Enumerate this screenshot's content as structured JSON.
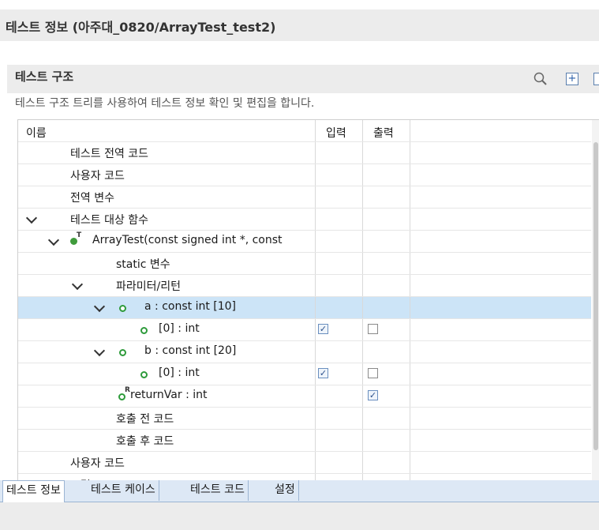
{
  "window": {
    "title": "테스트 정보 (아주대_0820/ArrayTest_test2)"
  },
  "section": {
    "title": "테스트 구조",
    "description": "테스트 구조 트리를 사용하여 테스트 정보 확인 및 편집을 합니다."
  },
  "toolbar": {
    "icons": [
      "search-icon",
      "expand-all-icon",
      "collapse-icon"
    ]
  },
  "tree": {
    "columns": [
      "이름",
      "입력",
      "출력"
    ],
    "rows": [
      {
        "label": "테스트 전역 코드"
      },
      {
        "label": "사용자 코드"
      },
      {
        "label": "전역 변수"
      },
      {
        "label": "테스트 대상 함수",
        "expanded": true
      },
      {
        "label": "ArrayTest(const signed int *, const",
        "icon": "function-icon",
        "icon_sup": "T",
        "expanded": true
      },
      {
        "label": "static 변수"
      },
      {
        "label": "파라미터/리턴",
        "expanded": true
      },
      {
        "label": "a  :  const int  [10]",
        "icon": "variable-icon",
        "expanded": true,
        "selected": true
      },
      {
        "label": "[0]  :  int",
        "icon": "variable-icon",
        "input": true,
        "output": false
      },
      {
        "label": "b  :  const int  [20]",
        "icon": "variable-icon",
        "expanded": true
      },
      {
        "label": "[0]  :  int",
        "icon": "variable-icon",
        "input": true,
        "output": false
      },
      {
        "label": "returnVar  :  int",
        "icon": "return-icon",
        "icon_sup": "R",
        "output": true
      },
      {
        "label": "호출 전 코드"
      },
      {
        "label": "호출 후 코드"
      },
      {
        "label": "사용자 코드"
      },
      {
        "label": "스텁"
      }
    ]
  },
  "tabs": [
    "테스트 정보",
    "테스트 케이스",
    "테스트 코드",
    "설정"
  ],
  "active_tab": "테스트 정보",
  "colors": {
    "selection": "#cce4f7",
    "tab_bar": "#dde8f5",
    "icon_green": "#2e9b3b"
  }
}
